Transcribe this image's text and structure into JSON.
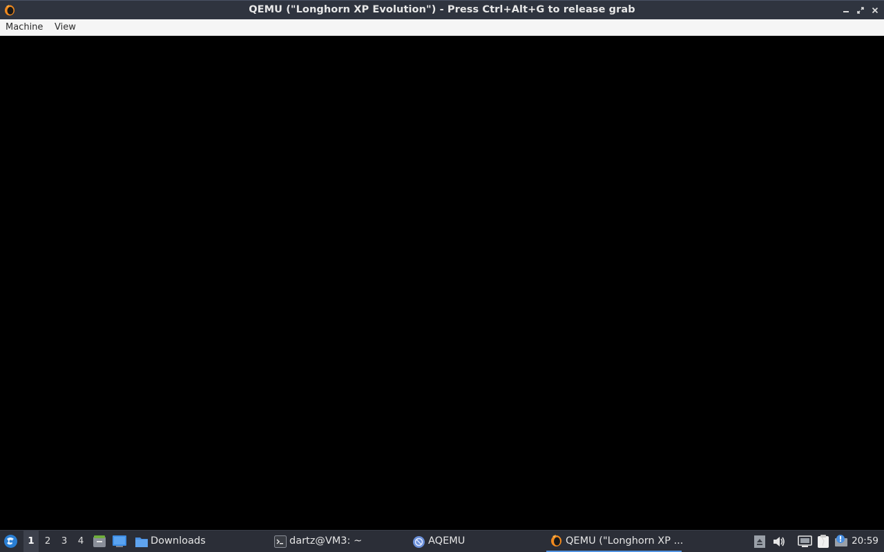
{
  "window": {
    "title": "QEMU (\"Longhorn XP Evolution\") - Press Ctrl+Alt+G to release grab",
    "app_icon": "qemu-icon",
    "controls": [
      "minimize-icon",
      "maximize-icon",
      "close-icon"
    ]
  },
  "menubar": {
    "items": [
      {
        "label": "Machine"
      },
      {
        "label": "View"
      }
    ]
  },
  "display": {
    "state": "blank",
    "background": "#000000"
  },
  "taskbar": {
    "start_icon": "lxqt-start-icon",
    "workspaces": [
      {
        "label": "1",
        "active": true
      },
      {
        "label": "2",
        "active": false
      },
      {
        "label": "3",
        "active": false
      },
      {
        "label": "4",
        "active": false
      }
    ],
    "quicklaunch": [
      "file-manager-icon",
      "show-desktop-icon"
    ],
    "tasks": [
      {
        "label": "Downloads",
        "icon": "folder-icon",
        "active": false
      },
      {
        "label": "dartz@VM3: ~",
        "icon": "terminal-icon",
        "active": false
      },
      {
        "label": "AQEMU",
        "icon": "aqemu-icon",
        "active": false
      },
      {
        "label": "QEMU (\"Longhorn XP ...",
        "icon": "qemu-icon",
        "active": true
      }
    ],
    "tray": [
      "eject-icon",
      "volume-icon",
      "network-icon",
      "clipboard-icon",
      "notification-icon"
    ],
    "clock": "20:59",
    "accent": "#5294e2"
  }
}
